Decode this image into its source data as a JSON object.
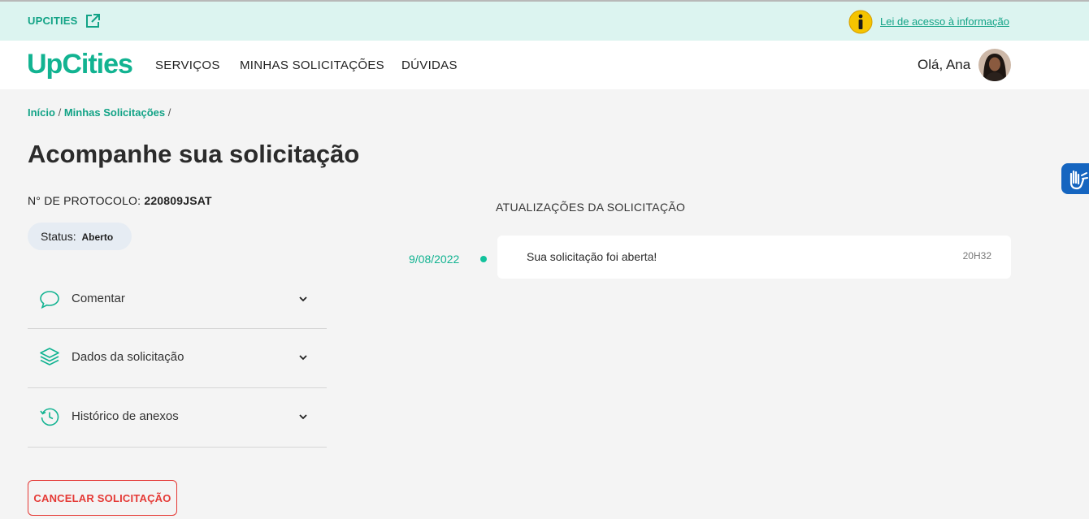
{
  "topbar": {
    "brand": "UPCITIES",
    "external_link_icon": "external-link-icon",
    "info_icon": "info-icon",
    "law_link": "Lei de acesso à informação"
  },
  "nav": {
    "logo": "UpCities",
    "links": [
      "SERVIÇOS",
      "MINHAS SOLICITAÇÕES",
      "DÚVIDAS"
    ],
    "greeting": "Olá, Ana",
    "avatar_icon": "user-avatar"
  },
  "breadcrumb": {
    "home": "Início",
    "separator": "/",
    "current": "Minhas Solicitações"
  },
  "page": {
    "title": "Acompanhe sua solicitação",
    "protocol_label": "N° DE PROTOCOLO:",
    "protocol_value": "220809JSAT",
    "status_label": "Status:",
    "status_value": "Aberto"
  },
  "accordion": [
    {
      "label": "Comentar",
      "icon": "chat-bubble-icon"
    },
    {
      "label": "Dados da solicitação",
      "icon": "layers-icon"
    },
    {
      "label": "Histórico de anexos",
      "icon": "history-clock-icon"
    }
  ],
  "cancel_button": "CANCELAR SOLICITAÇÃO",
  "updates": {
    "title": "ATUALIZAÇÕES DA SOLICITAÇÃO",
    "items": [
      {
        "date": "9/08/2022",
        "message": "Sua solicitação foi aberta!",
        "time": "20H32"
      }
    ]
  },
  "colors": {
    "brand": "#12b391",
    "brand_dark": "#12a386",
    "topbar_bg": "#dcf4f0",
    "danger": "#e53935",
    "status_bg": "#e6ecf3",
    "accessibility_blue": "#1565c0"
  }
}
